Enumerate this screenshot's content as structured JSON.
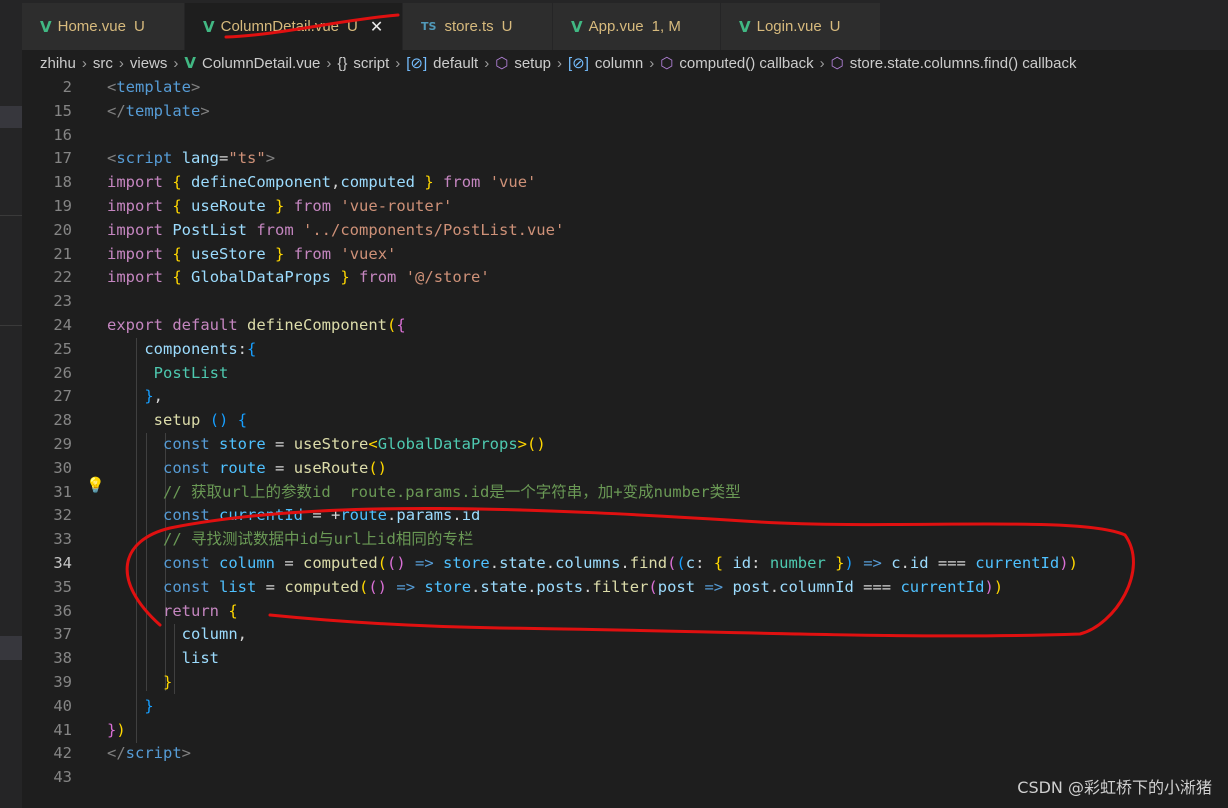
{
  "tabs": [
    {
      "icon": "vue-icon",
      "name": "Home.vue",
      "status": "U"
    },
    {
      "icon": "vue-icon",
      "name": "ColumnDetail.vue",
      "status": "U",
      "close": "✕"
    },
    {
      "icon": "ts-icon",
      "icon_text": "TS",
      "name": "store.ts",
      "status": "U"
    },
    {
      "icon": "vue-icon",
      "name": "App.vue",
      "status": "1, M"
    },
    {
      "icon": "vue-icon",
      "name": "Login.vue",
      "status": "U"
    }
  ],
  "breadcrumb": [
    "zhihu",
    "src",
    "views",
    "ColumnDetail.vue",
    "script",
    "default",
    "setup",
    "column",
    "computed() callback",
    "store.state.columns.find() callback"
  ],
  "editor": {
    "current_line": "34",
    "lines": [
      {
        "n": "2",
        "t": [
          [
            "tk-punc",
            "<"
          ],
          [
            "tk-tag",
            "template"
          ],
          [
            "tk-punc",
            ">"
          ]
        ]
      },
      {
        "n": "15",
        "t": [
          [
            "tk-punc",
            "</"
          ],
          [
            "tk-tag",
            "template"
          ],
          [
            "tk-punc",
            ">"
          ]
        ]
      },
      {
        "n": "16",
        "t": []
      },
      {
        "n": "17",
        "t": [
          [
            "tk-punc",
            "<"
          ],
          [
            "tk-tag",
            "script"
          ],
          [
            "tk-txt",
            " "
          ],
          [
            "tk-attr",
            "lang"
          ],
          [
            "tk-txt",
            "="
          ],
          [
            "tk-str",
            "\"ts\""
          ],
          [
            "tk-punc",
            ">"
          ]
        ]
      },
      {
        "n": "18",
        "t": [
          [
            "tk-kw2",
            "import"
          ],
          [
            "tk-txt",
            " "
          ],
          [
            "tk-br1",
            "{"
          ],
          [
            "tk-txt",
            " "
          ],
          [
            "tk-var",
            "defineComponent"
          ],
          [
            "tk-txt",
            ","
          ],
          [
            "tk-var",
            "computed"
          ],
          [
            "tk-txt",
            " "
          ],
          [
            "tk-br1",
            "}"
          ],
          [
            "tk-txt",
            " "
          ],
          [
            "tk-kw2",
            "from"
          ],
          [
            "tk-txt",
            " "
          ],
          [
            "tk-str",
            "'vue'"
          ]
        ]
      },
      {
        "n": "19",
        "t": [
          [
            "tk-kw2",
            "import"
          ],
          [
            "tk-txt",
            " "
          ],
          [
            "tk-br1",
            "{"
          ],
          [
            "tk-txt",
            " "
          ],
          [
            "tk-var",
            "useRoute"
          ],
          [
            "tk-txt",
            " "
          ],
          [
            "tk-br1",
            "}"
          ],
          [
            "tk-txt",
            " "
          ],
          [
            "tk-kw2",
            "from"
          ],
          [
            "tk-txt",
            " "
          ],
          [
            "tk-str",
            "'vue-router'"
          ]
        ]
      },
      {
        "n": "20",
        "t": [
          [
            "tk-kw2",
            "import"
          ],
          [
            "tk-txt",
            " "
          ],
          [
            "tk-var",
            "PostList"
          ],
          [
            "tk-txt",
            " "
          ],
          [
            "tk-kw2",
            "from"
          ],
          [
            "tk-txt",
            " "
          ],
          [
            "tk-str",
            "'../components/PostList.vue'"
          ]
        ]
      },
      {
        "n": "21",
        "t": [
          [
            "tk-kw2",
            "import"
          ],
          [
            "tk-txt",
            " "
          ],
          [
            "tk-br1",
            "{"
          ],
          [
            "tk-txt",
            " "
          ],
          [
            "tk-var",
            "useStore"
          ],
          [
            "tk-txt",
            " "
          ],
          [
            "tk-br1",
            "}"
          ],
          [
            "tk-txt",
            " "
          ],
          [
            "tk-kw2",
            "from"
          ],
          [
            "tk-txt",
            " "
          ],
          [
            "tk-str",
            "'vuex'"
          ]
        ]
      },
      {
        "n": "22",
        "t": [
          [
            "tk-kw2",
            "import"
          ],
          [
            "tk-txt",
            " "
          ],
          [
            "tk-br1",
            "{"
          ],
          [
            "tk-txt",
            " "
          ],
          [
            "tk-var",
            "GlobalDataProps"
          ],
          [
            "tk-txt",
            " "
          ],
          [
            "tk-br1",
            "}"
          ],
          [
            "tk-txt",
            " "
          ],
          [
            "tk-kw2",
            "from"
          ],
          [
            "tk-txt",
            " "
          ],
          [
            "tk-str",
            "'@/store'"
          ]
        ]
      },
      {
        "n": "23",
        "t": []
      },
      {
        "n": "24",
        "t": [
          [
            "tk-kw2",
            "export"
          ],
          [
            "tk-txt",
            " "
          ],
          [
            "tk-kw2",
            "default"
          ],
          [
            "tk-txt",
            " "
          ],
          [
            "tk-fn",
            "defineComponent"
          ],
          [
            "tk-br1",
            "("
          ],
          [
            "tk-br2",
            "{"
          ]
        ]
      },
      {
        "n": "25",
        "t": [
          [
            "tk-txt",
            "    "
          ],
          [
            "tk-var",
            "components"
          ],
          [
            "tk-txt",
            ":"
          ],
          [
            "tk-br3",
            "{"
          ]
        ]
      },
      {
        "n": "26",
        "t": [
          [
            "tk-txt",
            "     "
          ],
          [
            "tk-type",
            "PostList"
          ]
        ]
      },
      {
        "n": "27",
        "t": [
          [
            "tk-txt",
            "    "
          ],
          [
            "tk-br3",
            "}"
          ],
          [
            "tk-txt",
            ","
          ]
        ]
      },
      {
        "n": "28",
        "t": [
          [
            "tk-txt",
            "     "
          ],
          [
            "tk-fn",
            "setup"
          ],
          [
            "tk-txt",
            " "
          ],
          [
            "tk-br3",
            "()"
          ],
          [
            "tk-txt",
            " "
          ],
          [
            "tk-br3",
            "{"
          ]
        ]
      },
      {
        "n": "29",
        "t": [
          [
            "tk-txt",
            "      "
          ],
          [
            "tk-kw",
            "const"
          ],
          [
            "tk-txt",
            " "
          ],
          [
            "tk-const",
            "store"
          ],
          [
            "tk-txt",
            " = "
          ],
          [
            "tk-fn",
            "useStore"
          ],
          [
            "tk-br1",
            "<"
          ],
          [
            "tk-type",
            "GlobalDataProps"
          ],
          [
            "tk-br1",
            ">()"
          ]
        ]
      },
      {
        "n": "30",
        "t": [
          [
            "tk-txt",
            "      "
          ],
          [
            "tk-kw",
            "const"
          ],
          [
            "tk-txt",
            " "
          ],
          [
            "tk-const",
            "route"
          ],
          [
            "tk-txt",
            " = "
          ],
          [
            "tk-fn",
            "useRoute"
          ],
          [
            "tk-br1",
            "()"
          ]
        ]
      },
      {
        "n": "31",
        "t": [
          [
            "tk-txt",
            "      "
          ],
          [
            "tk-cmt",
            "// 获取url上的参数id  route.params.id是一个字符串，加+变成number类型"
          ]
        ]
      },
      {
        "n": "32",
        "t": [
          [
            "tk-txt",
            "      "
          ],
          [
            "tk-kw",
            "const"
          ],
          [
            "tk-txt",
            " "
          ],
          [
            "tk-const",
            "currentId"
          ],
          [
            "tk-txt",
            " = +"
          ],
          [
            "tk-const",
            "route"
          ],
          [
            "tk-txt",
            "."
          ],
          [
            "tk-var",
            "params"
          ],
          [
            "tk-txt",
            "."
          ],
          [
            "tk-var",
            "id"
          ]
        ]
      },
      {
        "n": "33",
        "t": [
          [
            "tk-txt",
            "      "
          ],
          [
            "tk-cmt",
            "// 寻找测试数据中id与url上id相同的专栏"
          ]
        ]
      },
      {
        "n": "34",
        "t": [
          [
            "tk-txt",
            "      "
          ],
          [
            "tk-kw",
            "const"
          ],
          [
            "tk-txt",
            " "
          ],
          [
            "tk-const",
            "column"
          ],
          [
            "tk-txt",
            " = "
          ],
          [
            "tk-fn",
            "computed"
          ],
          [
            "tk-br1",
            "("
          ],
          [
            "tk-br2",
            "()"
          ],
          [
            "tk-txt",
            " "
          ],
          [
            "tk-kw",
            "=>"
          ],
          [
            "tk-txt",
            " "
          ],
          [
            "tk-const",
            "store"
          ],
          [
            "tk-txt",
            "."
          ],
          [
            "tk-var",
            "state"
          ],
          [
            "tk-txt",
            "."
          ],
          [
            "tk-var",
            "columns"
          ],
          [
            "tk-txt",
            "."
          ],
          [
            "tk-fn",
            "find"
          ],
          [
            "tk-br2",
            "("
          ],
          [
            "tk-br3",
            "("
          ],
          [
            "tk-var",
            "c"
          ],
          [
            "tk-txt",
            ": "
          ],
          [
            "tk-br1",
            "{"
          ],
          [
            "tk-txt",
            " "
          ],
          [
            "tk-var",
            "id"
          ],
          [
            "tk-txt",
            ": "
          ],
          [
            "tk-type",
            "number"
          ],
          [
            "tk-txt",
            " "
          ],
          [
            "tk-br1",
            "}"
          ],
          [
            "tk-br3",
            ")"
          ],
          [
            "tk-txt",
            " "
          ],
          [
            "tk-kw",
            "=>"
          ],
          [
            "tk-txt",
            " "
          ],
          [
            "tk-var",
            "c"
          ],
          [
            "tk-txt",
            "."
          ],
          [
            "tk-var",
            "id"
          ],
          [
            "tk-txt",
            " === "
          ],
          [
            "tk-const",
            "currentId"
          ],
          [
            "tk-br2",
            ")"
          ],
          [
            "tk-br1",
            ")"
          ]
        ]
      },
      {
        "n": "35",
        "t": [
          [
            "tk-txt",
            "      "
          ],
          [
            "tk-kw",
            "const"
          ],
          [
            "tk-txt",
            " "
          ],
          [
            "tk-const",
            "list"
          ],
          [
            "tk-txt",
            " = "
          ],
          [
            "tk-fn",
            "computed"
          ],
          [
            "tk-br1",
            "("
          ],
          [
            "tk-br2",
            "()"
          ],
          [
            "tk-txt",
            " "
          ],
          [
            "tk-kw",
            "=>"
          ],
          [
            "tk-txt",
            " "
          ],
          [
            "tk-const",
            "store"
          ],
          [
            "tk-txt",
            "."
          ],
          [
            "tk-var",
            "state"
          ],
          [
            "tk-txt",
            "."
          ],
          [
            "tk-var",
            "posts"
          ],
          [
            "tk-txt",
            "."
          ],
          [
            "tk-fn",
            "filter"
          ],
          [
            "tk-br2",
            "("
          ],
          [
            "tk-var",
            "post"
          ],
          [
            "tk-txt",
            " "
          ],
          [
            "tk-kw",
            "=>"
          ],
          [
            "tk-txt",
            " "
          ],
          [
            "tk-var",
            "post"
          ],
          [
            "tk-txt",
            "."
          ],
          [
            "tk-var",
            "columnId"
          ],
          [
            "tk-txt",
            " === "
          ],
          [
            "tk-const",
            "currentId"
          ],
          [
            "tk-br2",
            ")"
          ],
          [
            "tk-br1",
            ")"
          ]
        ]
      },
      {
        "n": "36",
        "t": [
          [
            "tk-txt",
            "      "
          ],
          [
            "tk-kw2",
            "return"
          ],
          [
            "tk-txt",
            " "
          ],
          [
            "tk-br1",
            "{"
          ]
        ]
      },
      {
        "n": "37",
        "t": [
          [
            "tk-txt",
            "        "
          ],
          [
            "tk-var",
            "column"
          ],
          [
            "tk-txt",
            ","
          ]
        ]
      },
      {
        "n": "38",
        "t": [
          [
            "tk-txt",
            "        "
          ],
          [
            "tk-var",
            "list"
          ]
        ]
      },
      {
        "n": "39",
        "t": [
          [
            "tk-txt",
            "      "
          ],
          [
            "tk-br1",
            "}"
          ]
        ]
      },
      {
        "n": "40",
        "t": [
          [
            "tk-txt",
            "    "
          ],
          [
            "tk-br3",
            "}"
          ]
        ]
      },
      {
        "n": "41",
        "t": [
          [
            "tk-br2",
            "}"
          ],
          [
            "tk-br1",
            ")"
          ]
        ]
      },
      {
        "n": "42",
        "t": [
          [
            "tk-punc",
            "</"
          ],
          [
            "tk-tag",
            "script"
          ],
          [
            "tk-punc",
            ">"
          ]
        ]
      },
      {
        "n": "43",
        "t": []
      }
    ]
  },
  "watermark": "CSDN @彩虹桥下的小淅猪",
  "colors": {
    "annotation_red": "#e01010",
    "vue_green": "#41b883",
    "modified_gold": "#d7ba7d"
  }
}
